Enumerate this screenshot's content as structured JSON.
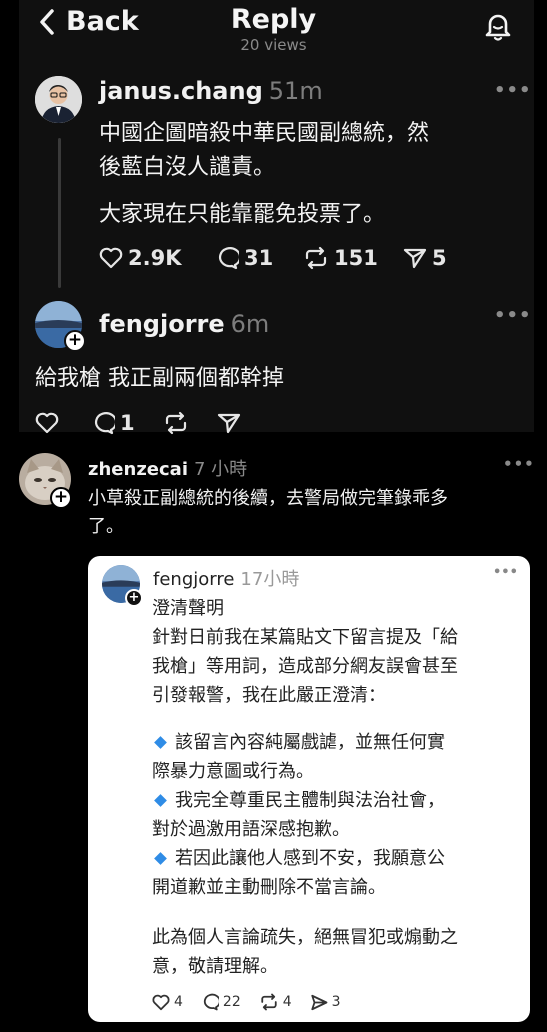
{
  "header": {
    "back_label": "Back",
    "title": "Reply",
    "views": "20 views"
  },
  "post1": {
    "username": "janus.chang",
    "time": "51m",
    "text_line1": "中國企圖暗殺中華民國副總統，然",
    "text_line2": "後藍白沒人譴責。",
    "text_line3": "大家現在只能靠罷免投票了。",
    "likes": "2.9K",
    "replies": "31",
    "reposts": "151",
    "shares": "5"
  },
  "post2": {
    "username": "fengjorre",
    "time": "6m",
    "text": "給我槍 我正副兩個都幹掉",
    "replies": "1"
  },
  "post3": {
    "username": "zhenzecai",
    "time": "7 小時",
    "text_line1": "小草殺正副總統的後續，去警局做完筆錄乖多",
    "text_line2": "了。"
  },
  "quoted": {
    "username": "fengjorre",
    "time": "17小時",
    "title": "澄清聲明",
    "para1_l1": "針對日前我在某篇貼文下留言提及「給",
    "para1_l2": "我槍」等用詞，造成部分網友誤會甚至",
    "para1_l3": "引發報警，我在此嚴正澄清：",
    "b1_l1": "該留言內容純屬戲謔，並無任何實",
    "b1_l2": "際暴力意圖或行為。",
    "b2_l1": "我完全尊重民主體制與法治社會，",
    "b2_l2": "對於過激用語深感抱歉。",
    "b3_l1": "若因此讓他人感到不安，我願意公",
    "b3_l2": "開道歉並主動刪除不當言論。",
    "para2_l1": "此為個人言論疏失，絕無冒犯或煽動之",
    "para2_l2": "意，敬請理解。",
    "likes": "4",
    "replies": "22",
    "reposts": "4",
    "shares": "3"
  },
  "colors": {
    "dark_panel": "#101010",
    "background": "#000000",
    "card": "#ffffff",
    "bullet": "#2f8ce6"
  },
  "icons": [
    "chevron-left-icon",
    "bell-icon",
    "more-icon",
    "heart-icon",
    "comment-icon",
    "repost-icon",
    "send-icon",
    "plus-icon",
    "diamond-bullet-icon"
  ]
}
